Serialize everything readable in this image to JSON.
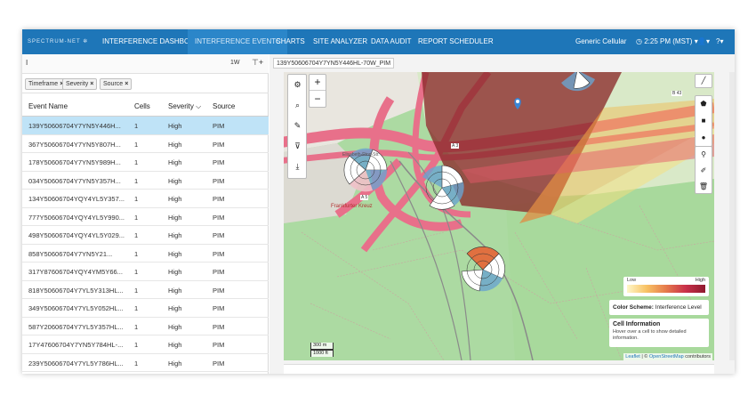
{
  "brand": {
    "logo_text": "SPECTRUM-NET",
    "logo_glyph": "✲"
  },
  "nav": {
    "items": [
      {
        "label": "INTERFERENCE DASHBOARD"
      },
      {
        "label": "INTERFERENCE EVENTS"
      },
      {
        "label": "CHARTS"
      },
      {
        "label": "SITE ANALYZER"
      },
      {
        "label": "DATA AUDIT"
      },
      {
        "label": "REPORT SCHEDULER"
      }
    ],
    "account": "Generic Cellular",
    "time": "2:25 PM (MST)",
    "user_glyph": "👤",
    "help_glyph": "?",
    "caret": "▾",
    "clock_glyph": "◷"
  },
  "left": {
    "search_value": "I",
    "range": "1W",
    "filter_glyph": "⊤+",
    "chips": [
      {
        "label": "Timeframe"
      },
      {
        "label": "Severity"
      },
      {
        "label": "Source"
      }
    ],
    "chip_close": "×",
    "columns": {
      "name": "Event Name",
      "cells": "Cells",
      "severity": "Severity",
      "sort_glyph": "⌵",
      "source": "Source"
    },
    "rows": [
      {
        "name": "139Y50606704Y7YN5Y446H...",
        "cells": "1",
        "severity": "High",
        "source": "PIM"
      },
      {
        "name": "367Y50606704Y7YN5Y807H...",
        "cells": "1",
        "severity": "High",
        "source": "PIM"
      },
      {
        "name": "178Y50606704Y7YN5Y989H...",
        "cells": "1",
        "severity": "High",
        "source": "PIM"
      },
      {
        "name": "034Y50606704Y7YN5Y357H...",
        "cells": "1",
        "severity": "High",
        "source": "PIM"
      },
      {
        "name": "134Y50606704YQY4YL5Y357...",
        "cells": "1",
        "severity": "High",
        "source": "PIM"
      },
      {
        "name": "777Y50606704YQY4YL5Y990...",
        "cells": "1",
        "severity": "High",
        "source": "PIM"
      },
      {
        "name": "498Y50606704YQY4YL5Y029...",
        "cells": "1",
        "severity": "High",
        "source": "PIM"
      },
      {
        "name": "858Y50606704Y7YN5Y21...",
        "cells": "1",
        "severity": "High",
        "source": "PIM"
      },
      {
        "name": "317Y87606704YQY4YM5Y66...",
        "cells": "1",
        "severity": "High",
        "source": "PIM"
      },
      {
        "name": "818Y50606704Y7YL5Y313HL...",
        "cells": "1",
        "severity": "High",
        "source": "PIM"
      },
      {
        "name": "349Y50606704Y7YL5Y052HL...",
        "cells": "1",
        "severity": "High",
        "source": "PIM"
      },
      {
        "name": "587Y20606704Y7YL5Y357HL...",
        "cells": "1",
        "severity": "High",
        "source": "PIM"
      },
      {
        "name": "17Y47606704Y7YN5Y784HL-...",
        "cells": "1",
        "severity": "High",
        "source": "PIM"
      },
      {
        "name": "239Y50606704Y7YL5Y786HL...",
        "cells": "1",
        "severity": "High",
        "source": "PIM"
      }
    ]
  },
  "map": {
    "tab_label": "139Y50606704Y7YN5Y446HL-70W_PIM",
    "tools": {
      "settings": "⚙",
      "search": "⌕",
      "brush": "✎",
      "filter": "⊽",
      "download": "⤓"
    },
    "zoom_in": "+",
    "zoom_out": "−",
    "draw_tools": {
      "line": "╱",
      "polygon": "⬟",
      "rectangle": "■",
      "circle": "●",
      "marker": "⚲",
      "edit": "✐",
      "delete": "🗑"
    },
    "legend": {
      "low": "Low",
      "high": "High"
    },
    "color_scheme_label": "Color Scheme:",
    "color_scheme_value": "Interference Level",
    "cell_info_title": "Cell Information",
    "cell_info_text": "Hover over a cell to show detailed information.",
    "scale_m": "300 m",
    "scale_ft": "1000 ft",
    "attrib_leaflet": "Leaflet",
    "attrib_sep": "| ©",
    "attrib_osm": "OpenStreetMap",
    "attrib_suffix": "contributors",
    "labels": {
      "kreuz": "Frankfurter Kreuz",
      "a3": "A 3",
      "a5": "A 5",
      "b43": "B 43",
      "street": "Elisabeth-Ring-Str."
    }
  }
}
